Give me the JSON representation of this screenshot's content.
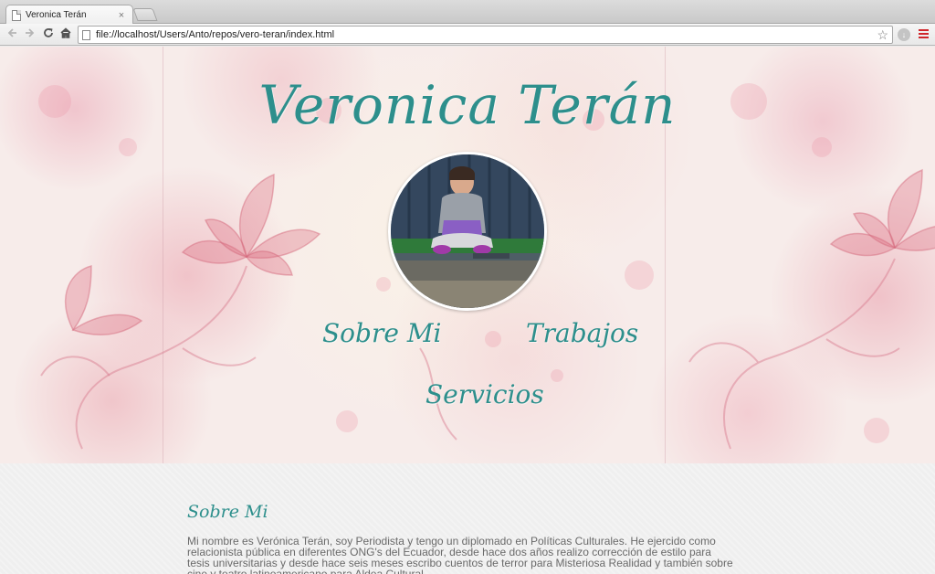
{
  "browser": {
    "tab_title": "Veronica Terán",
    "tab_close": "×",
    "url": "file://localhost/Users/Anto/repos/vero-teran/index.html",
    "back_icon": "arrow-left-icon",
    "forward_icon": "arrow-right-icon",
    "reload_icon": "reload-icon",
    "home_icon": "home-icon",
    "star_icon": "star-icon",
    "menu_icon": "hamburger-menu-icon",
    "menu_color": "#d0262b"
  },
  "site": {
    "title": "Veronica Terán",
    "accent_color": "#2d8f8c",
    "nav": {
      "sobre_mi": "Sobre Mi",
      "trabajos": "Trabajos",
      "servicios": "Servicios"
    }
  },
  "about": {
    "heading": "Sobre Mi",
    "text": "Mi nombre es Verónica Terán, soy Periodista y tengo un diplomado en Políticas Culturales. He ejercido como relacionista pública en diferentes ONG's del Ecuador, desde hace dos años realizo corrección de estilo para tesis universitarias y desde hace seis meses escribo cuentos de terror para Misteriosa Realidad y también sobre cine y teatro latinoamericano para Aldea Cultural."
  }
}
